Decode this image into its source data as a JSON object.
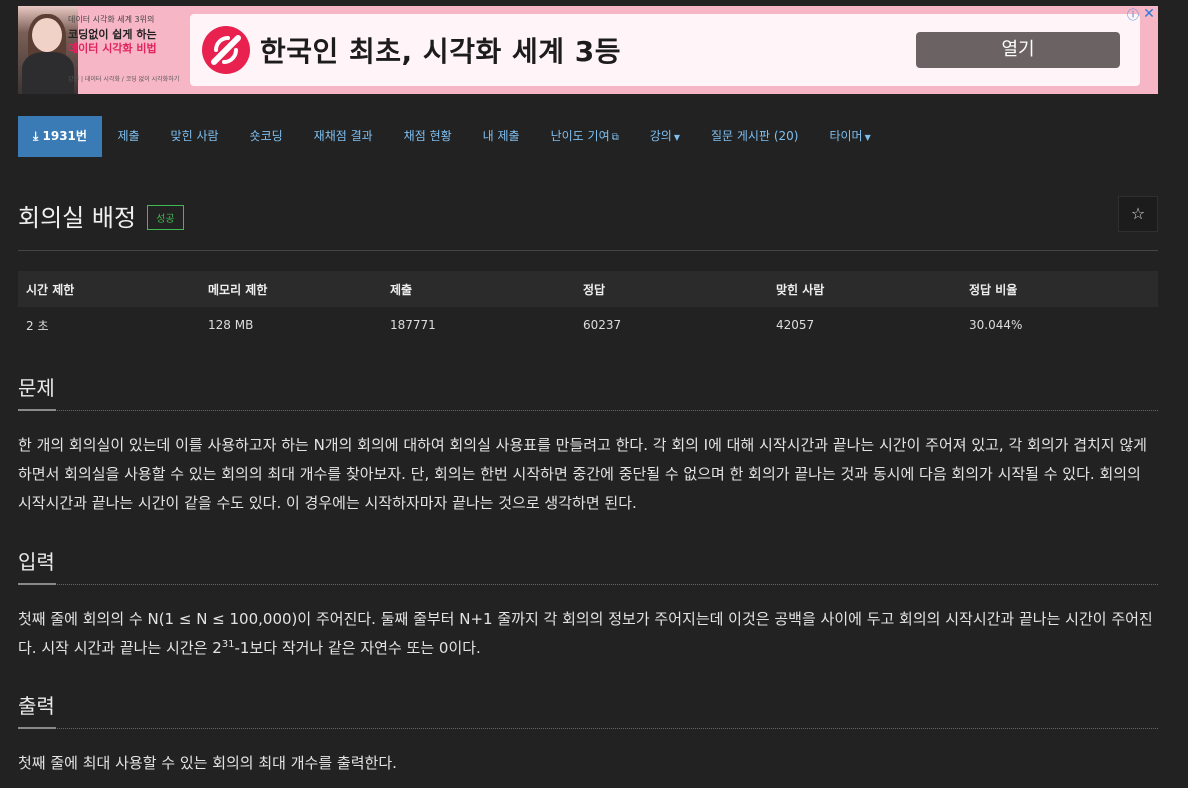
{
  "ad": {
    "small_text": "데이터 시각화 세계 3위의",
    "promo_line1": "코딩없이 쉽게 하는",
    "promo_line2": "데이터 시각화 비법",
    "tiny_text": "강연 | 데이터 시각화 / 코딩 없이 시각화하기",
    "headline": "한국인 최초, 시각화 세계 3등",
    "open_label": "열기",
    "info_icon": "ⓘ",
    "close_icon": "✕"
  },
  "nav": {
    "items": [
      {
        "label": "1931번",
        "icon": "download-icon"
      },
      {
        "label": "제출"
      },
      {
        "label": "맞힌 사람"
      },
      {
        "label": "숏코딩"
      },
      {
        "label": "재채점 결과"
      },
      {
        "label": "채점 현황"
      },
      {
        "label": "내 제출"
      },
      {
        "label": "난이도 기여"
      },
      {
        "label": "강의"
      },
      {
        "label": "질문 게시판 (20)"
      },
      {
        "label": "타이머"
      }
    ]
  },
  "problem": {
    "title": "회의실 배정",
    "badge": "성공",
    "star": "☆"
  },
  "info_table": {
    "headers": [
      "시간 제한",
      "메모리 제한",
      "제출",
      "정답",
      "맞힌 사람",
      "정답 비율"
    ],
    "row": [
      "2 초",
      "128 MB",
      "187771",
      "60237",
      "42057",
      "30.044%"
    ]
  },
  "sections": {
    "problem": {
      "heading": "문제",
      "text": "한 개의 회의실이 있는데 이를 사용하고자 하는 N개의 회의에 대하여 회의실 사용표를 만들려고 한다. 각 회의 I에 대해 시작시간과 끝나는 시간이 주어져 있고, 각 회의가 겹치지 않게 하면서 회의실을 사용할 수 있는 회의의 최대 개수를 찾아보자. 단, 회의는 한번 시작하면 중간에 중단될 수 없으며 한 회의가 끝나는 것과 동시에 다음 회의가 시작될 수 있다. 회의의 시작시간과 끝나는 시간이 같을 수도 있다. 이 경우에는 시작하자마자 끝나는 것으로 생각하면 된다."
    },
    "input": {
      "heading": "입력",
      "text": "첫째 줄에 회의의 수 N(1 ≤ N ≤ 100,000)이 주어진다. 둘째 줄부터 N+1 줄까지 각 회의의 정보가 주어지는데 이것은 공백을 사이에 두고 회의의 시작시간과 끝나는 시간이 주어진다. 시작 시간과 끝나는 시간은 2",
      "sup": "31",
      "text_after": "-1보다 작거나 같은 자연수 또는 0이다."
    },
    "output": {
      "heading": "출력",
      "text": "첫째 줄에 최대 사용할 수 있는 회의의 최대 개수를 출력한다."
    }
  }
}
